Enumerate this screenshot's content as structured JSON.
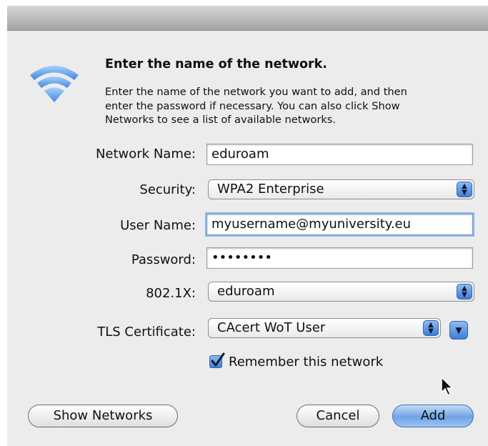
{
  "dialog": {
    "heading": "Enter the name of the network.",
    "description_lines": [
      "Enter the name of the network you want to add, and then",
      "enter the password if necessary. You can also click Show",
      "Networks to see a list of available networks."
    ]
  },
  "form": {
    "network_name": {
      "label": "Network Name:",
      "value": "eduroam"
    },
    "security": {
      "label": "Security:",
      "value": "WPA2 Enterprise"
    },
    "user_name": {
      "label": "User Name:",
      "value": "myusername@myuniversity.eu"
    },
    "password": {
      "label": "Password:",
      "value": "••••••••"
    },
    "dot1x": {
      "label": "802.1X:",
      "value": "eduroam"
    },
    "tls_certificate": {
      "label": "TLS Certificate:",
      "value": "CAcert WoT User"
    },
    "remember": {
      "label": "Remember this network",
      "checked": true
    }
  },
  "buttons": {
    "show_networks": "Show Networks",
    "cancel": "Cancel",
    "add": "Add"
  },
  "icons": {
    "wifi": "wifi-icon",
    "cursor": "mouse-pointer-icon"
  },
  "colors": {
    "accent": "#3e7ed6",
    "wifi": "#6aa8f0"
  }
}
